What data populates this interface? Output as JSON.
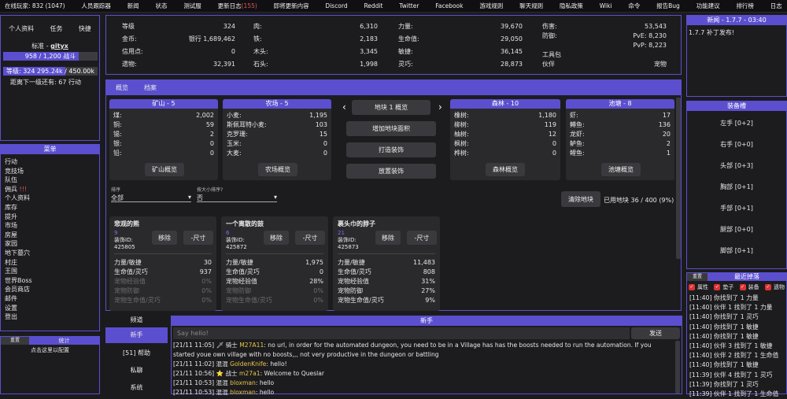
{
  "topbar": [
    "在线玩家: 832 (1047)",
    "人员跟踪器",
    "新闻",
    "状态",
    "测试服",
    "更新日志",
    "(155)",
    "即将更新内容",
    "Discord",
    "Reddit",
    "Twitter",
    "Facebook",
    "游戏规则",
    "聊天规则",
    "隐私政策",
    "Wiki",
    "命令",
    "报告Bug",
    "功能建议",
    "排行榜",
    "日志"
  ],
  "left": {
    "tabs": [
      "个人资料",
      "任务",
      "快捷"
    ],
    "rank_prefix": "标准 - ",
    "username": "gityx",
    "combat": "958 / 1,200 战斗",
    "level": "等级: 324 295.24k / 450.00k",
    "next": "距离下一级还有: 67 行动",
    "menu_title": "菜单",
    "menu": [
      "行动",
      "竞技场",
      "队伍",
      "佣兵",
      "!!!",
      "个人资料",
      "库存",
      "提升",
      "市场",
      "房屋",
      "家园",
      "地下墓穴",
      "村庄",
      "王国",
      "世界Boss",
      "会员商店",
      "邮件",
      "设置",
      "登出"
    ],
    "bottom_tabs": [
      "重置",
      "统计"
    ],
    "bottom_text": "点击这里以配置"
  },
  "stats": {
    "col1": [
      [
        "等级",
        "324"
      ],
      [
        "金币:",
        "银行 1,689,462"
      ],
      [
        "信用点:",
        "0"
      ],
      [
        "遗物:",
        "32,391"
      ]
    ],
    "col2": [
      [
        "肉:",
        "6,310"
      ],
      [
        "铁:",
        "2,183"
      ],
      [
        "木头:",
        "3,345"
      ],
      [
        "石头:",
        "1,998"
      ]
    ],
    "col3": [
      [
        "力量:",
        "39,670"
      ],
      [
        "生命值:",
        "29,050"
      ],
      [
        "敏捷:",
        "36,145"
      ],
      [
        "灵巧:",
        "28,873"
      ]
    ],
    "col4": {
      "damage_label": "伤害:",
      "damage": "53,543",
      "defense_label": "防御:",
      "pve": "PvE: 8,230",
      "pvp": "PvP: 8,223",
      "toolkit": "工具包",
      "partner_label": "伙伴",
      "partner": "宠物"
    }
  },
  "main_tabs": [
    "概览",
    "档案"
  ],
  "mine": {
    "title": "矿山 - 5",
    "rows": [
      [
        "煤:",
        "2,002"
      ],
      [
        "铜:",
        "59"
      ],
      [
        "锡:",
        "2"
      ],
      [
        "银:",
        "0"
      ],
      [
        "铅:",
        "0"
      ]
    ],
    "btn": "矿山概览"
  },
  "farm": {
    "title": "农场 - 5",
    "rows": [
      [
        "小麦:",
        "1,195"
      ],
      [
        "斯佩耳特小麦:",
        "103"
      ],
      [
        "克罗珊:",
        "15"
      ],
      [
        "玉米:",
        "0"
      ],
      [
        "大麦:",
        "0"
      ]
    ],
    "btn": "农场概览"
  },
  "center_btns": [
    "地块 1 概览",
    "增加地块面积",
    "打造装饰",
    "放置装饰"
  ],
  "forest": {
    "title": "森林 - 10",
    "rows": [
      [
        "橡树:",
        "1,180"
      ],
      [
        "柳树:",
        "119"
      ],
      [
        "柚树:",
        "12"
      ],
      [
        "枫树:",
        "0"
      ],
      [
        "桦树:",
        "0"
      ]
    ],
    "btn": "森林概览"
  },
  "pond": {
    "title": "池塘 - 8",
    "rows": [
      [
        "虾:",
        "17"
      ],
      [
        "鳟鱼:",
        "136"
      ],
      [
        "龙虾:",
        "20"
      ],
      [
        "鲈鱼:",
        "2"
      ],
      [
        "鲤鱼:",
        "1"
      ]
    ],
    "btn": "池塘概览"
  },
  "filters": {
    "sort_label": "排序",
    "sort_value": "全部",
    "size_label": "按大小排序?",
    "size_value": "否",
    "clear_btn": "清除地块",
    "used": "已用地块 36 / 400 (9%)"
  },
  "decor": [
    {
      "name": "悲观的熊",
      "num": "9",
      "id_label": "装饰ID:",
      "id": "425805",
      "remove": "移除",
      "shrink": "-尺寸",
      "rows": [
        [
          "力量/敏捷",
          "30"
        ],
        [
          "生命值/灵巧",
          "937"
        ]
      ],
      "dim": [
        [
          "宠物经验值",
          "0%"
        ],
        [
          "宠物防御",
          "0%"
        ],
        [
          "宠物生命值/灵巧",
          "0%"
        ]
      ]
    },
    {
      "name": "一个离散的鼓",
      "num": "6",
      "id_label": "装饰ID:",
      "id": "425872",
      "remove": "移除",
      "shrink": "-尺寸",
      "rows": [
        [
          "力量/敏捷",
          "1,975"
        ],
        [
          "生命值/灵巧",
          "0"
        ],
        [
          "宠物经验值",
          "28%"
        ]
      ],
      "dim": [
        [
          "宠物防御",
          "0%"
        ],
        [
          "宠物生命值/灵巧",
          "0%"
        ]
      ]
    },
    {
      "name": "裹头巾的脖子",
      "num": "21",
      "id_label": "装饰ID:",
      "id": "425873",
      "remove": "移除",
      "shrink": "-尺寸",
      "rows": [
        [
          "力量/敏捷",
          "11,483"
        ],
        [
          "生命值/灵巧",
          "808"
        ],
        [
          "宠物经验值",
          "31%"
        ],
        [
          "宠物防御",
          "27%"
        ],
        [
          "宠物生命值/灵巧",
          "9%"
        ]
      ],
      "dim": []
    }
  ],
  "channels": {
    "title": "频道",
    "items": [
      "新手",
      "[51] 帮助",
      "私聊",
      "系统"
    ]
  },
  "chat": {
    "title": "新手",
    "placeholder": "Say hello!",
    "send": "发送",
    "lines": [
      {
        "t": "[21/11 11:05]",
        "icon": "🗡",
        "who": "骑士",
        "name": "M27A11",
        "msg": ": no url, in order for the automated dungeon, you need to be in a Village has has the boosts needed to run the automation. If you started youe own village with no boosts,,, not very productive in the dungeon or battling"
      },
      {
        "t": "[21/11 11:02]",
        "icon": "",
        "who": "混混",
        "name": "GoldenKnife",
        "msg": ": hello!"
      },
      {
        "t": "[21/11 10:56]",
        "icon": "⭐",
        "who": "战士",
        "name": "m27a1",
        "msg": ": Welcome to Queslar"
      },
      {
        "t": "[21/11 10:53]",
        "icon": "",
        "who": "混混",
        "name": "bloxman",
        "msg": ": hello"
      },
      {
        "t": "[21/11 10:53]",
        "icon": "",
        "who": "混混",
        "name": "bloxman",
        "msg": ": hello"
      }
    ]
  },
  "news": {
    "title": "新闻 - 1.7.7 - 03:40",
    "text": "1.7.7 补丁发布!"
  },
  "equip": {
    "title": "装备槽",
    "slots": [
      "左手 [0+2]",
      "右手 [0+0]",
      "头部 [0+3]",
      "胸部 [0+1]",
      "手部 [0+1]",
      "腿部 [0+0]",
      "脚部 [0+1]"
    ]
  },
  "drops": {
    "title": "最近掉落",
    "checks": [
      "属性",
      "垫子",
      "装备",
      "遗物"
    ],
    "lines": [
      "[11:40] 你找到了 1 力量",
      "[11:40] 伙伴 1 找到了 1 力量",
      "[11:40] 你找到了 1 灵巧",
      "[11:40] 你找到了 1 敏捷",
      "[11:40] 你找到了 1 敏捷",
      "[11:40] 伙伴 3 找到了 1 敏捷",
      "[11:40] 伙伴 2 找到了 1 生命值",
      "[11:40] 你找到了 1 敏捷",
      "[11:39] 伙伴 4 找到了 1 灵巧",
      "[11:39] 你找到了 1 灵巧",
      "[11:39] 伙伴 1 找到了 1 生命值"
    ]
  }
}
